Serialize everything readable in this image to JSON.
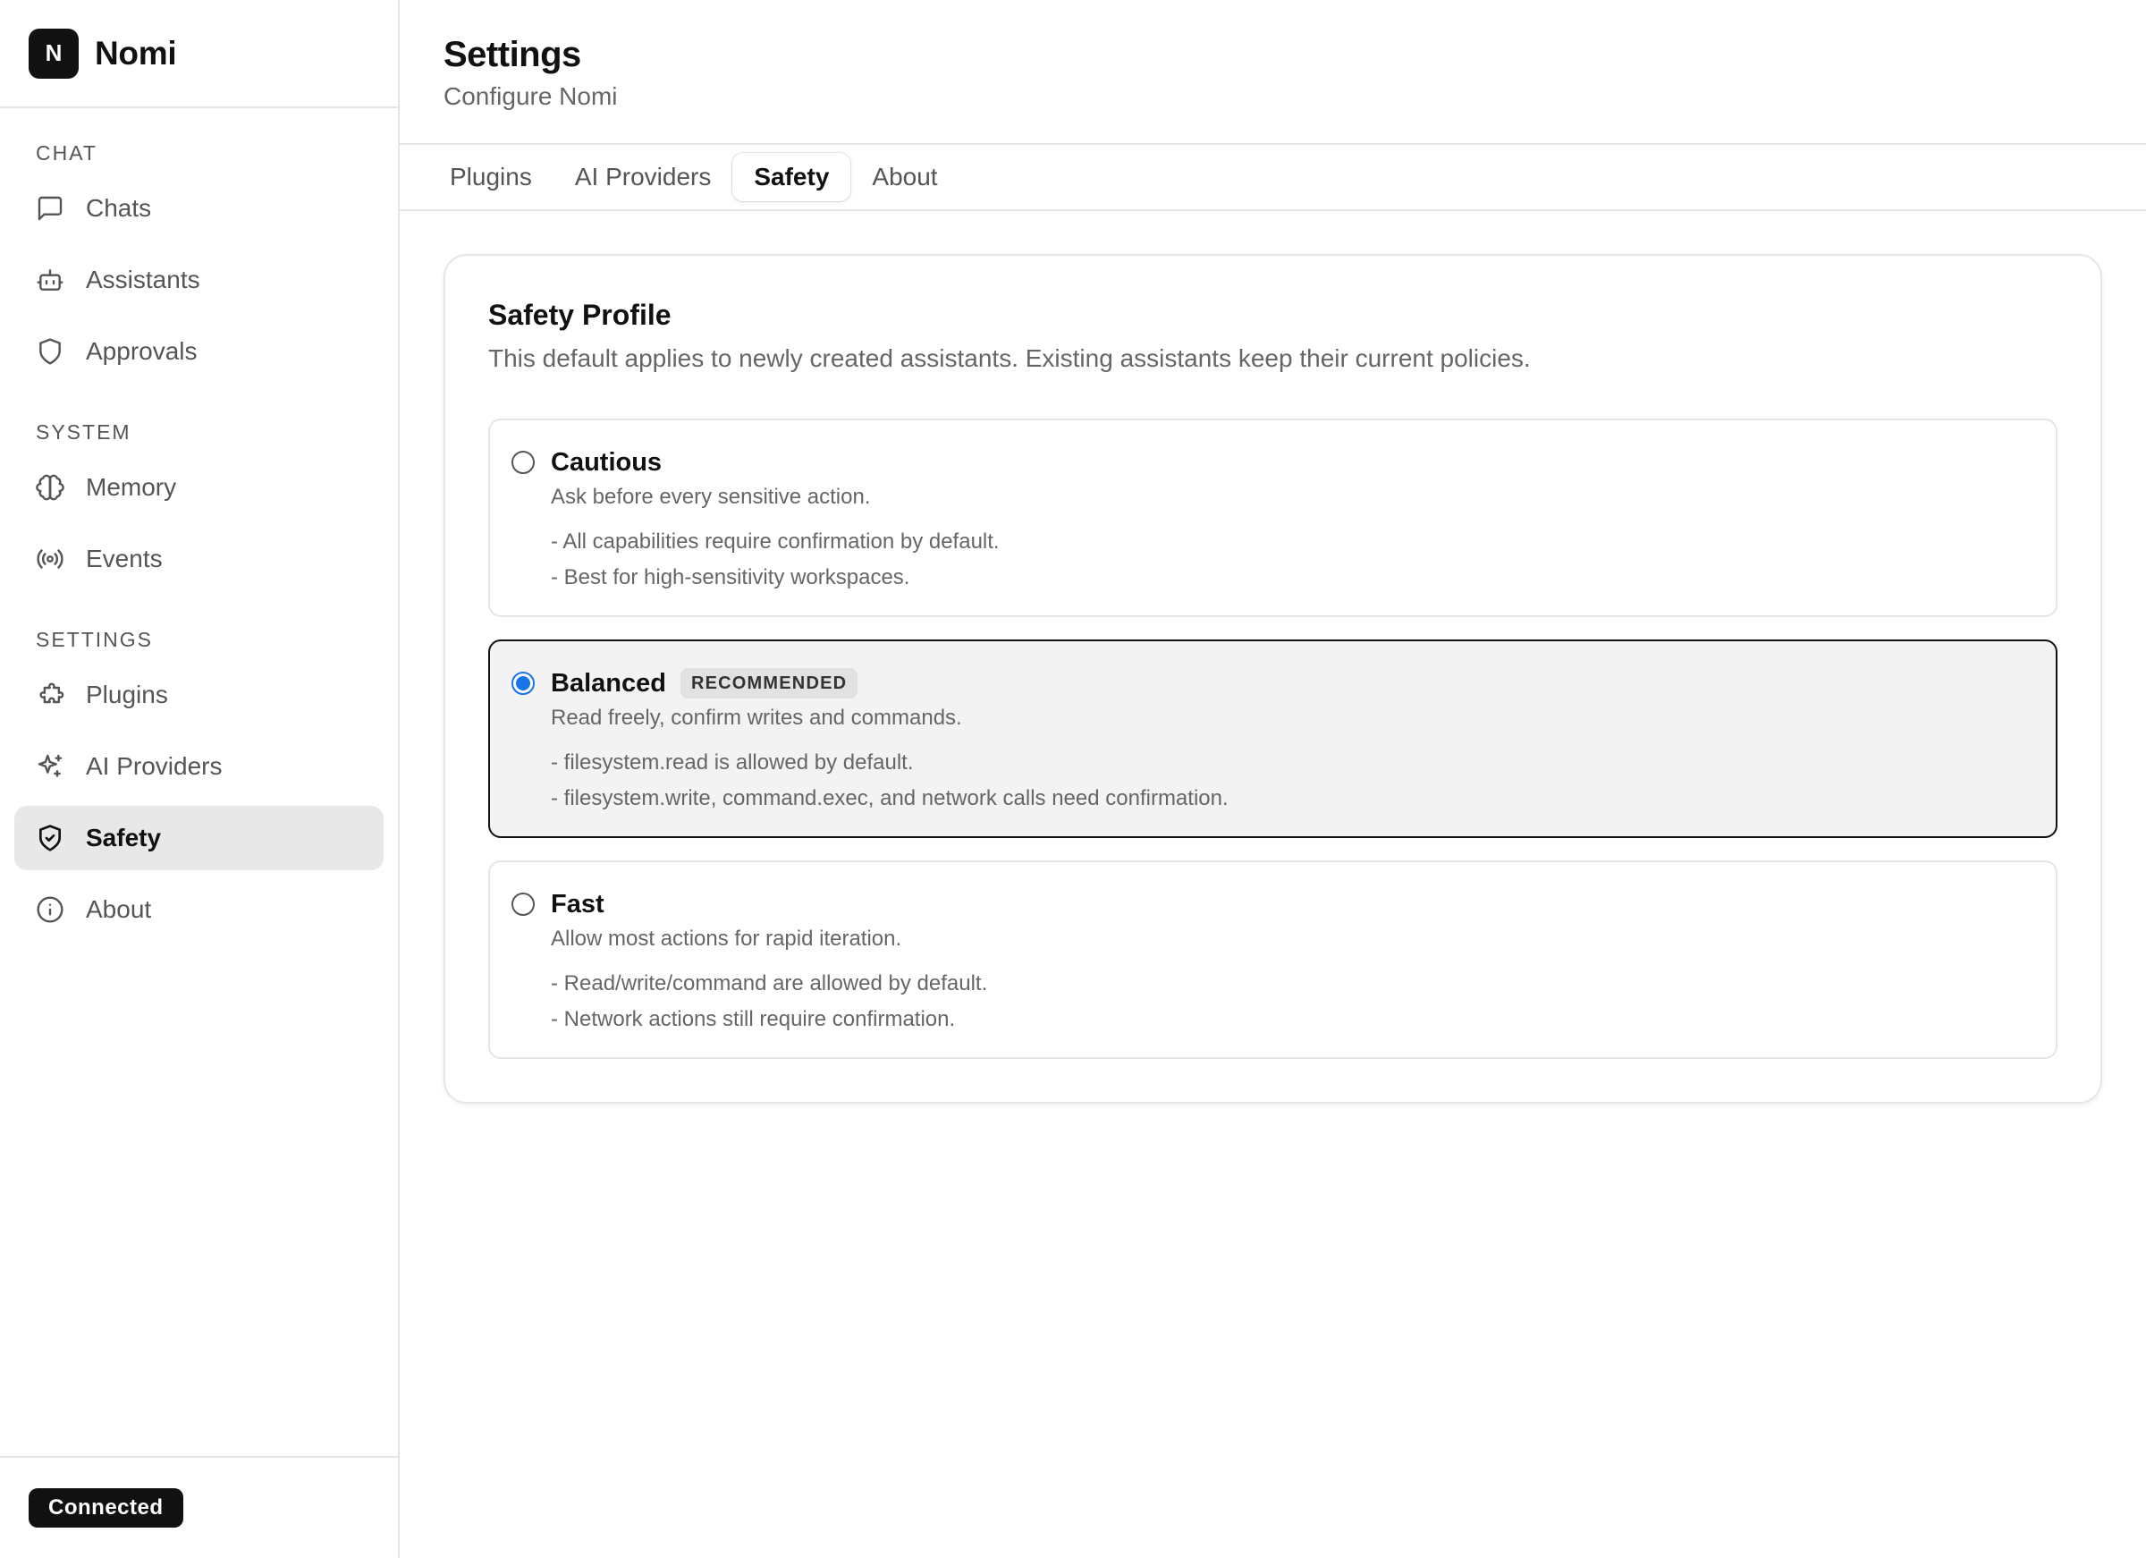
{
  "brand": {
    "logo_letter": "N",
    "name": "Nomi"
  },
  "sidebar": {
    "sections": [
      {
        "label": "CHAT",
        "items": [
          {
            "label": "Chats",
            "icon": "message-square-icon",
            "active": false
          },
          {
            "label": "Assistants",
            "icon": "bot-icon",
            "active": false
          },
          {
            "label": "Approvals",
            "icon": "shield-icon",
            "active": false
          }
        ]
      },
      {
        "label": "SYSTEM",
        "items": [
          {
            "label": "Memory",
            "icon": "brain-icon",
            "active": false
          },
          {
            "label": "Events",
            "icon": "radio-icon",
            "active": false
          }
        ]
      },
      {
        "label": "SETTINGS",
        "items": [
          {
            "label": "Plugins",
            "icon": "puzzle-icon",
            "active": false
          },
          {
            "label": "AI Providers",
            "icon": "sparkles-icon",
            "active": false
          },
          {
            "label": "Safety",
            "icon": "shield-check-icon",
            "active": true
          },
          {
            "label": "About",
            "icon": "info-icon",
            "active": false
          }
        ]
      }
    ],
    "status": "Connected"
  },
  "header": {
    "title": "Settings",
    "subtitle": "Configure Nomi"
  },
  "tabs": [
    {
      "label": "Plugins",
      "active": false
    },
    {
      "label": "AI Providers",
      "active": false
    },
    {
      "label": "Safety",
      "active": true
    },
    {
      "label": "About",
      "active": false
    }
  ],
  "safety": {
    "title": "Safety Profile",
    "description": "This default applies to newly created assistants. Existing assistants keep their current policies.",
    "options": [
      {
        "title": "Cautious",
        "badge": "",
        "selected": false,
        "subtitle": "Ask before every sensitive action.",
        "bullets": [
          "- All capabilities require confirmation by default.",
          "- Best for high-sensitivity workspaces."
        ]
      },
      {
        "title": "Balanced",
        "badge": "RECOMMENDED",
        "selected": true,
        "subtitle": "Read freely, confirm writes and commands.",
        "bullets": [
          "- filesystem.read is allowed by default.",
          "- filesystem.write, command.exec, and network calls need confirmation."
        ]
      },
      {
        "title": "Fast",
        "badge": "",
        "selected": false,
        "subtitle": "Allow most actions for rapid iteration.",
        "bullets": [
          "- Read/write/command are allowed by default.",
          "- Network actions still require confirmation."
        ]
      }
    ]
  },
  "colors": {
    "accent": "#1a73e8",
    "active_bg": "#e8e8e8",
    "border": "#e6e6e6"
  }
}
